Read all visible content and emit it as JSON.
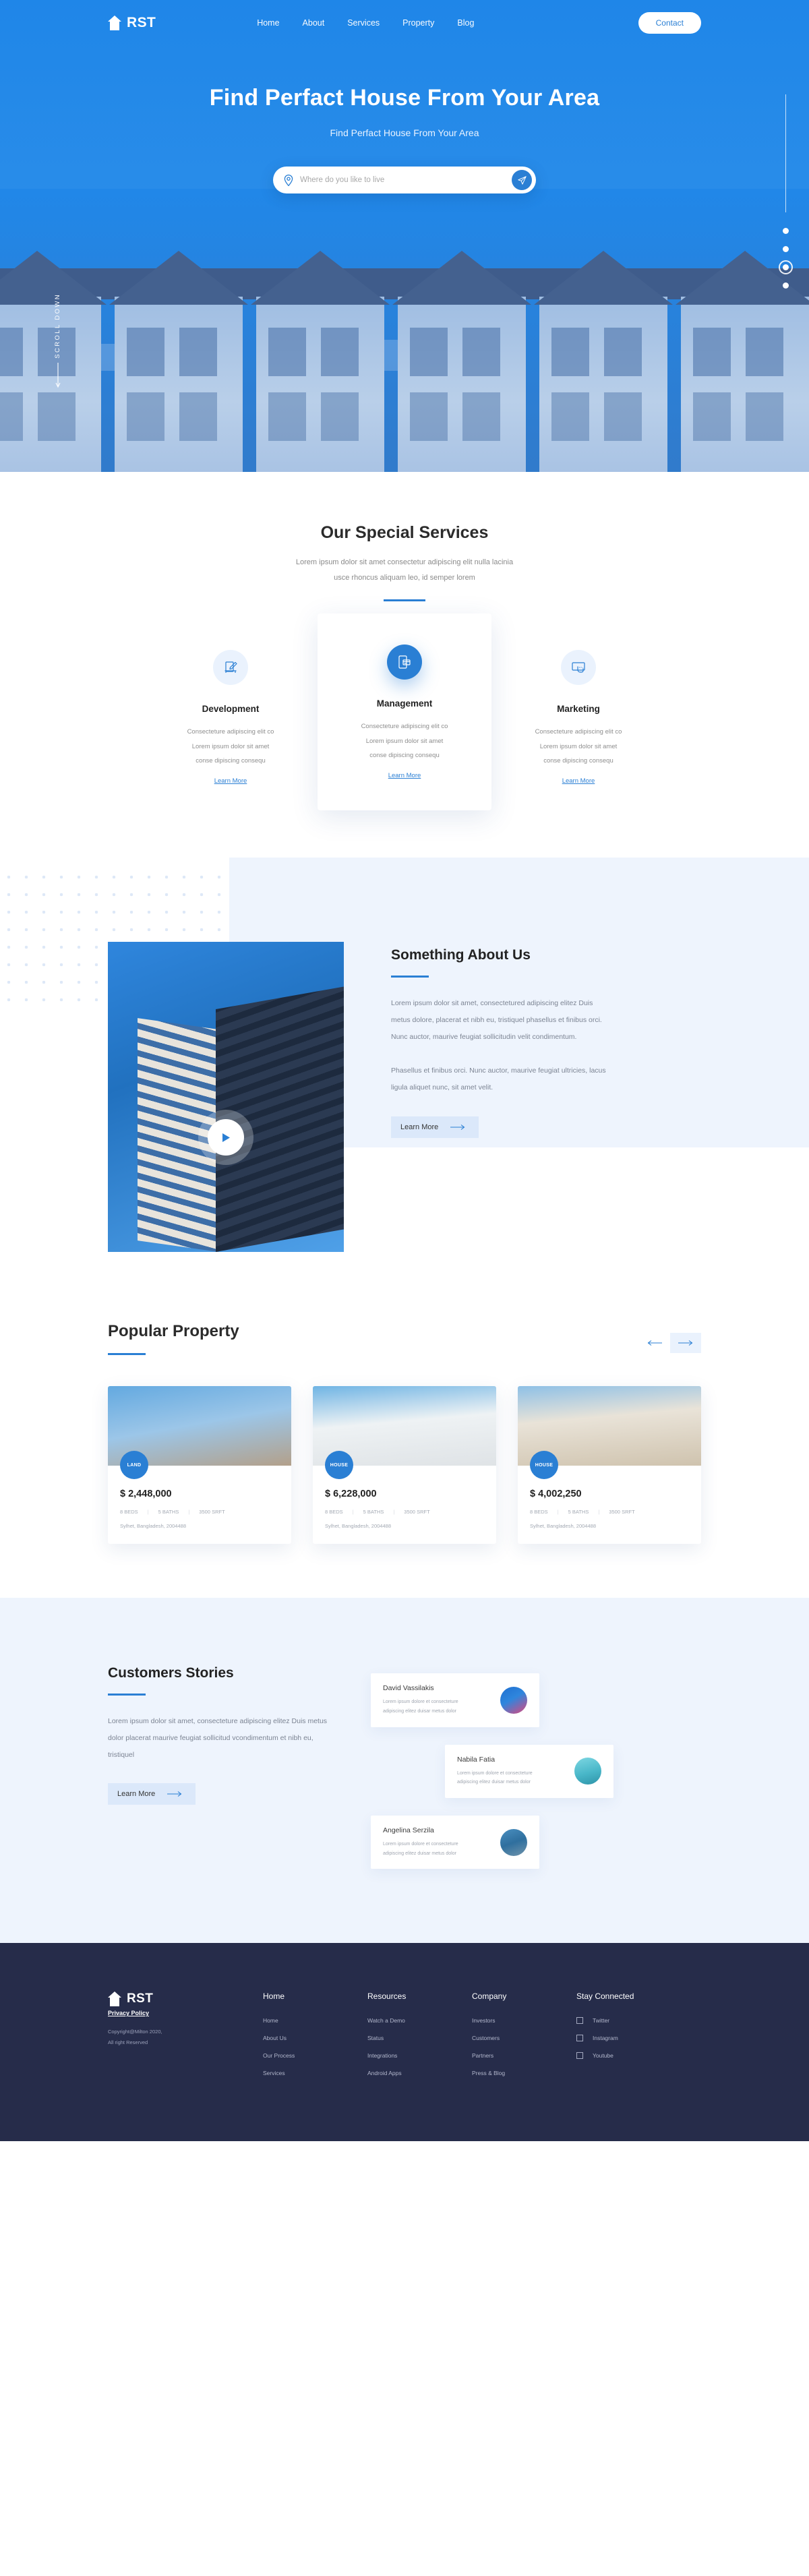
{
  "brand": {
    "name": "RST",
    "icon": "house-icon"
  },
  "nav": {
    "links": [
      {
        "label": "Home"
      },
      {
        "label": "About"
      },
      {
        "label": "Services"
      },
      {
        "label": "Property"
      },
      {
        "label": "Blog"
      }
    ],
    "contact_label": "Contact"
  },
  "hero": {
    "title": "Find Perfact House From Your Area",
    "subtitle": "Find Perfact House From Your Area",
    "search_placeholder": "Where do you like to live",
    "search_value": "",
    "pin_icon": "location-pin-icon",
    "send_icon": "send-icon",
    "scroll_label": "SCROLL DOWN",
    "slider_dots": 4,
    "slider_active_index": 2
  },
  "services": {
    "title": "Our Special Services",
    "subtitle_line1": "Lorem ipsum dolor sit amet consectetur adipiscing elit nulla lacinia",
    "subtitle_line2": "usce rhoncus aliquam leo, id semper lorem",
    "cards": [
      {
        "name": "Development",
        "icon": "document-pencil-icon",
        "desc_line1": "Consecteture adipiscing elit co",
        "desc_line2": "Lorem ipsum dolor sit amet",
        "desc_line3": "conse dipiscing consequ",
        "link": "Learn More"
      },
      {
        "name": "Management",
        "icon": "mobile-card-icon",
        "desc_line1": "Consecteture adipiscing elit co",
        "desc_line2": "Lorem ipsum dolor sit amet",
        "desc_line3": "conse dipiscing consequ",
        "link": "Learn More"
      },
      {
        "name": "Marketing",
        "icon": "touch-screen-icon",
        "desc_line1": "Consecteture adipiscing elit co",
        "desc_line2": "Lorem ipsum dolor sit amet",
        "desc_line3": "conse dipiscing consequ",
        "link": "Learn More"
      }
    ]
  },
  "about": {
    "title": "Something About Us",
    "paragraph1": "Lorem ipsum dolor sit amet, consectetured adipiscing elitez Duis metus dolore, placerat et nibh eu, tristiquel phasellus et finibus orci. Nunc auctor, maurive feugiat sollicitudin velit condimentum.",
    "paragraph2": "Phasellus et finibus orci. Nunc auctor, maurive feugiat ultricies, lacus ligula aliquet nunc, sit amet velit.",
    "button_label": "Learn More",
    "play_icon": "play-button-icon"
  },
  "property": {
    "title": "Popular Property",
    "prev_icon": "arrow-left-icon",
    "next_icon": "arrow-right-icon",
    "cards": [
      {
        "badge": "LAND",
        "price": "$ 2,448,000",
        "beds": "8 BEDS",
        "baths": "5 BATHS",
        "area": "3500 SRFT",
        "address": "Sylhet, Bangladesh, 2004488"
      },
      {
        "badge": "HOUSE",
        "price": "$ 6,228,000",
        "beds": "8 BEDS",
        "baths": "5 BATHS",
        "area": "3500 SRFT",
        "address": "Sylhet, Bangladesh, 2004488"
      },
      {
        "badge": "HOUSE",
        "price": "$ 4,002,250",
        "beds": "8 BEDS",
        "baths": "5 BATHS",
        "area": "3500 SRFT",
        "address": "Sylhet, Bangladesh, 2004488"
      }
    ]
  },
  "stories": {
    "title": "Customers Stories",
    "paragraph": "Lorem ipsum dolor sit amet, consecteture adipiscing elitez Duis metus dolor placerat maurive feugiat sollicitud vcondimentum et nibh eu, tristiquel",
    "button_label": "Learn More",
    "testimonials": [
      {
        "name": "David Vassilakis",
        "quote_line1": "Lorem ipsum dolore et consecteture",
        "quote_line2": "adipiscing elitez duisar metus dolor"
      },
      {
        "name": "Nabila Fatia",
        "quote_line1": "Lorem ipsum dolore et consecteture",
        "quote_line2": "adipiscing elitez duisar metus dolor"
      },
      {
        "name": "Angelina Serzila",
        "quote_line1": "Lorem ipsum dolore et consecteture",
        "quote_line2": "adipiscing elitez duisar metus dolor"
      }
    ]
  },
  "footer": {
    "privacy": "Privacy Policy",
    "copyright_line1": "Copyright@Milton 2020,",
    "copyright_line2": "All right Reserved",
    "columns": [
      {
        "heading": "Home",
        "links": [
          {
            "label": "Home"
          },
          {
            "label": "About Us"
          },
          {
            "label": " Our Process"
          },
          {
            "label": "Services"
          }
        ]
      },
      {
        "heading": "Resources",
        "links": [
          {
            "label": "Watch a Demo"
          },
          {
            "label": "Status"
          },
          {
            "label": "Integrations"
          },
          {
            "label": "Android Apps"
          }
        ]
      },
      {
        "heading": "Company",
        "links": [
          {
            "label": "Investors"
          },
          {
            "label": "Customers"
          },
          {
            "label": "Partners"
          },
          {
            "label": "Press & Blog"
          }
        ]
      }
    ],
    "social": {
      "heading": "Stay Connected",
      "items": [
        {
          "label": "Twitter",
          "icon": "twitter-icon"
        },
        {
          "label": "Instagram",
          "icon": "instagram-icon"
        },
        {
          "label": "Youtube",
          "icon": "youtube-icon"
        }
      ]
    }
  },
  "colors": {
    "accent": "#2a7fd4",
    "hero": "#1f86e8",
    "footer": "#262c4a",
    "soft": "#eef4fd"
  }
}
